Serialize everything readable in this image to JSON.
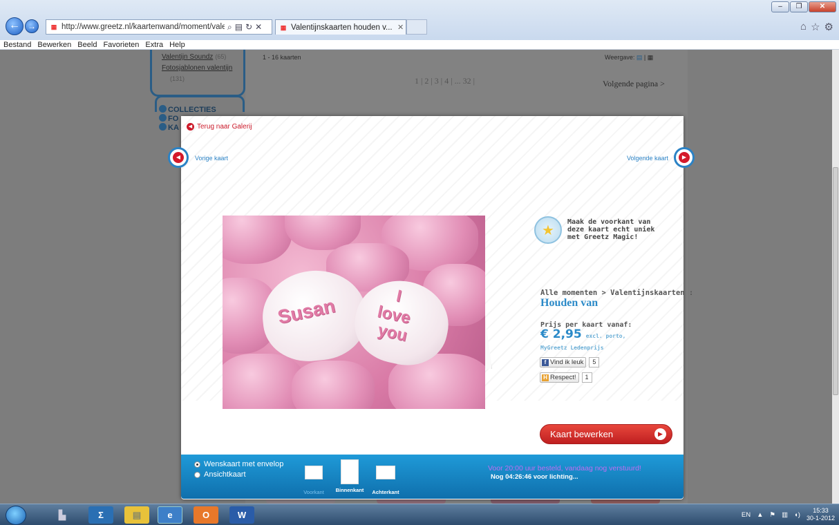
{
  "browser": {
    "url": "http://www.greetz.nl/kaartenwand/moment/valentij",
    "tab_title": "Valentijnskaarten houden v...",
    "menu": [
      "Bestand",
      "Bewerken",
      "Beeld",
      "Favorieten",
      "Extra",
      "Help"
    ]
  },
  "background_page": {
    "link1": "Valentijn Soundz",
    "link1_count": "(65)",
    "link2": "Fotosjablonen valentijn",
    "link2_count": "(131)",
    "count": "1 - 16 kaarten",
    "weergave": "Weergave:",
    "pages": "1 | 2 | 3 | 4 | ... 32 |",
    "next_page": "Volgende pagina >",
    "collecties": "COLLECTIES",
    "fo": "FO",
    "ka": "KA"
  },
  "modal": {
    "back_link": "Terug naar Galerij",
    "prev": "Vorige kaart",
    "next": "Volgende kaart",
    "heart1": "Susan",
    "heart2_line1": "I",
    "heart2_line2": "love",
    "heart2_line3": "you",
    "magic_text": "Maak de voorkant van deze kaart echt uniek met Greetz Magic!",
    "breadcrumb": "Alle momenten > Valentijnskaarten :",
    "title": "Houden van",
    "price_label": "Prijs per kaart vanaf:",
    "price": "€ 2,95",
    "price_note": "excl. porto,",
    "member_price": "MyGreetz Ledenprijs",
    "like_label": "Vind ik leuk",
    "like_count": "5",
    "respect_label": "Respect!",
    "respect_count": "1",
    "edit_button": "Kaart bewerken",
    "option1": "Wenskaart met envelop",
    "option2": "Ansichtkaart",
    "view_front": "Voorkant",
    "view_inside": "Binnenkant",
    "view_back": "Achterkant",
    "shipping_promo": "Voor 20:00 uur besteld, vandaag nog verstuurd!",
    "shipping_timer": "Nog 04:26:46  voor lichting..."
  },
  "taskbar": {
    "lang": "EN",
    "time": "15:33",
    "date": "30-1-2012"
  },
  "colors": {
    "accent_blue": "#2b82c5",
    "accent_red": "#cc1a2a"
  }
}
